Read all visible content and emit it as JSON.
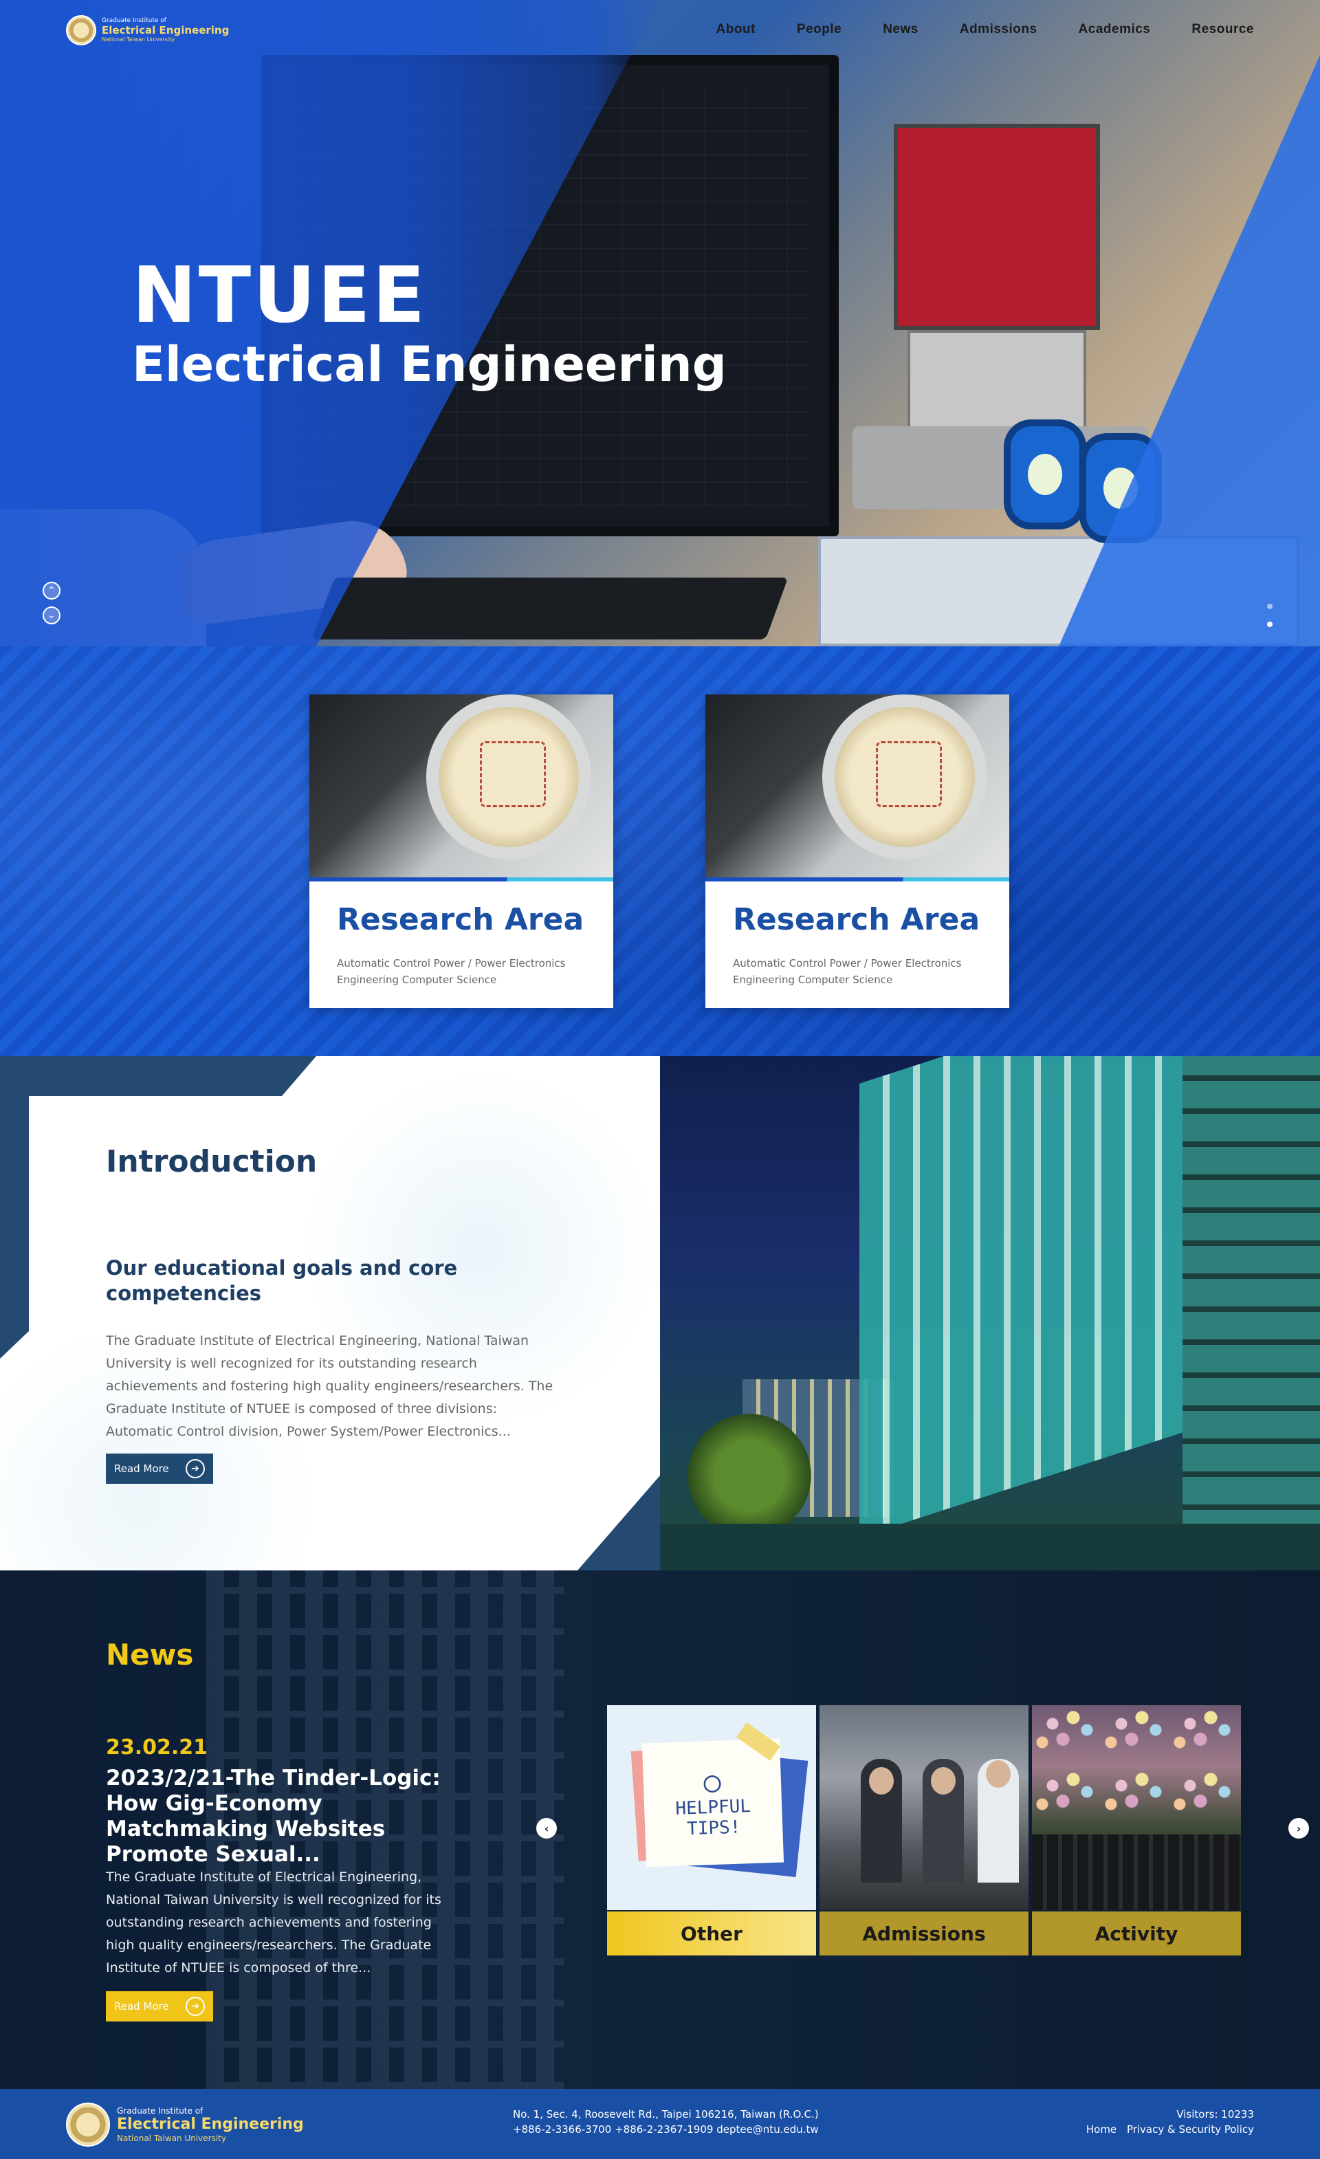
{
  "header": {
    "logo": {
      "line1": "Graduate Institute of",
      "line2": "Electrical Engineering",
      "line3": "National Taiwan University"
    },
    "nav": [
      "About",
      "People",
      "News",
      "Admissions",
      "Academics",
      "Resource"
    ]
  },
  "hero": {
    "title": "NTUEE",
    "subtitle": "Electrical Engineering",
    "prev_icon": "chevron-up-icon",
    "next_icon": "chevron-down-icon",
    "slides_count": 2,
    "active_slide": 2
  },
  "research": {
    "cards": [
      {
        "title": "Research Area",
        "desc": "Automatic Control Power / Power Electronics Engineering Computer Science"
      },
      {
        "title": "Research Area",
        "desc": "Automatic Control Power / Power Electronics Engineering Computer Science"
      }
    ]
  },
  "intro": {
    "title": "Introduction",
    "subtitle": "Our educational goals and core competencies",
    "body": "The Graduate Institute of Electrical Engineering, National Taiwan University is well recognized for its outstanding research achievements and fostering high quality engineers/researchers. The Graduate Institute of NTUEE is composed of three divisions: Automatic Control division, Power System/Power Electronics...",
    "button": "Read More"
  },
  "news": {
    "title": "News",
    "date": "23.02.21",
    "headline": "2023/2/21-The Tinder-Logic: How Gig-Economy Matchmaking Websites Promote Sexual...",
    "body": "The Graduate Institute of Electrical Engineering, National Taiwan University is well recognized for its outstanding research achievements and fostering high quality engineers/researchers. The Graduate Institute of NTUEE is composed of thre...",
    "button": "Read More",
    "tips_text": "HELPFUL TIPS!",
    "categories": [
      {
        "label": "Other",
        "color": "#f3d23e"
      },
      {
        "label": "Admissions",
        "color": "#b59a26"
      },
      {
        "label": "Activity",
        "color": "#b59a26"
      }
    ]
  },
  "footer": {
    "logo": {
      "line1": "Graduate Institute of",
      "line2": "Electrical Engineering",
      "line3": "National Taiwan University"
    },
    "address": "No. 1, Sec. 4, Roosevelt Rd., Taipei 106216, Taiwan (R.O.C.)",
    "contact": "+886-2-3366-3700  +886-2-2367-1909  deptee@ntu.edu.tw",
    "visitors": "Visitors: 10233",
    "links": [
      "Home",
      "Privacy & Security Policy"
    ]
  },
  "colors": {
    "primary_blue": "#1a4fa6",
    "research_blue": "#1552c9",
    "intro_navy": "#214a73",
    "news_bg": "#0b1c33",
    "accent_yellow": "#f0c518"
  }
}
